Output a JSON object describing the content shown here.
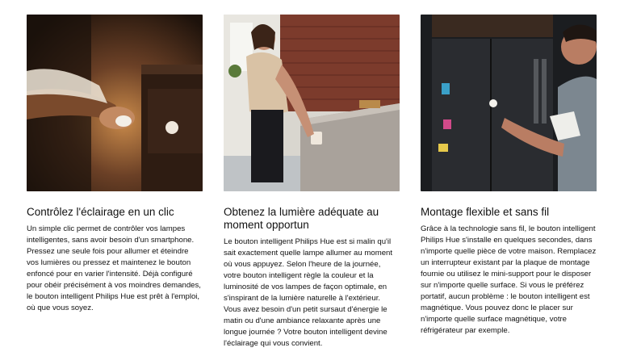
{
  "features": [
    {
      "image_alt": "Main appuyant sur le bouton près d'une table de chevet",
      "title": "Contrôlez l'éclairage en un clic",
      "body": "Un simple clic permet de contrôler vos lampes intelligentes, sans avoir besoin d'un smartphone. Pressez une seule fois pour allumer et éteindre vos lumières ou pressez et maintenez le bouton enfoncé pour en varier l'intensité. Déjà configuré pour obéir précisément à vos moindres demandes, le bouton intelligent Philips Hue est prêt à l'emploi, où que vous soyez."
    },
    {
      "image_alt": "Femme appuyant sur le bouton fixé sur un îlot de cuisine",
      "title": "Obtenez la lumière adéquate au moment opportun",
      "body": "Le bouton intelligent Philips Hue est si malin qu'il sait exactement quelle lampe allumer au moment où vous appuyez. Selon l'heure de la journée, votre bouton intelligent règle la couleur et la luminosité de vos lampes de façon optimale, en s'inspirant de la lumière naturelle à l'extérieur. Vous avez besoin d'un petit sursaut d'énergie le matin ou d'une ambiance relaxante après une longue journée ? Votre bouton intelligent devine l'éclairage qui vous convient."
    },
    {
      "image_alt": "Homme appuyant sur le bouton fixé sur un réfrigérateur",
      "title": "Montage flexible et sans fil",
      "body": "Grâce à la technologie sans fil, le bouton intelligent Philips Hue s'installe en quelques secondes, dans n'importe quelle pièce de votre maison. Remplacez un interrupteur existant par la plaque de montage fournie ou utilisez le mini-support pour le disposer sur n'importe quelle surface. Si vous le préférez portatif, aucun problème : le bouton intelligent est magnétique. Vous pouvez donc le placer sur n'importe quelle surface magnétique, votre réfrigérateur par exemple."
    }
  ]
}
